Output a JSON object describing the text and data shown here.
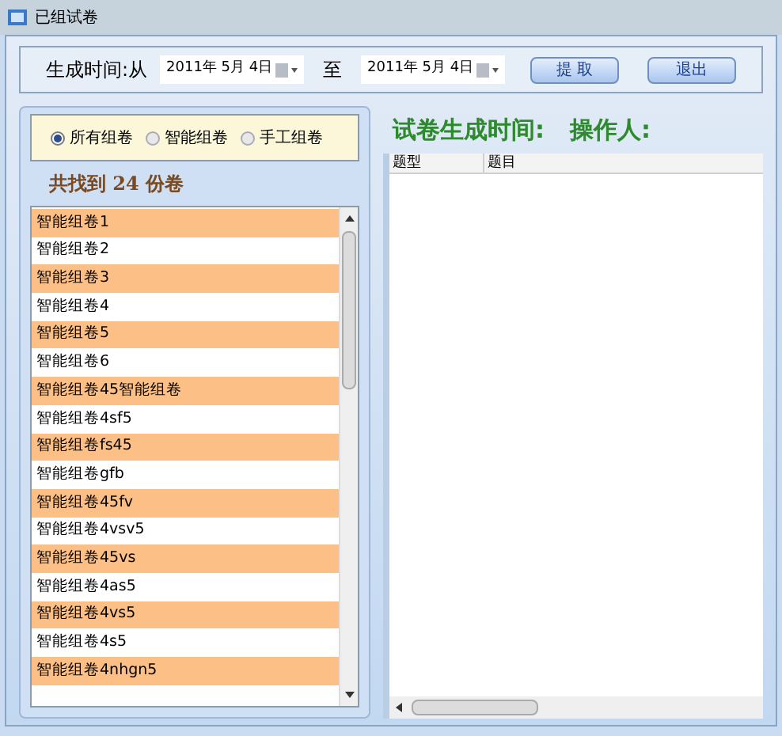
{
  "window": {
    "title": "已组试卷"
  },
  "filter": {
    "from_label": "生成时间:从",
    "from_date": "2011年 5月 4日",
    "to_label": "至",
    "to_date": "2011年 5月 4日",
    "buttons": [
      "提 取",
      "退出"
    ]
  },
  "group_types": [
    {
      "label": "所有组卷",
      "selected": true
    },
    {
      "label": "智能组卷",
      "selected": false
    },
    {
      "label": "手工组卷",
      "selected": false
    }
  ],
  "count_text": "共找到 24 份卷",
  "papers": [
    "智能组卷1",
    "智能组卷2",
    "智能组卷3",
    "智能组卷4",
    "智能组卷5",
    "智能组卷6",
    "智能组卷45智能组卷",
    "智能组卷4sf5",
    "智能组卷fs45",
    "智能组卷gfb",
    "智能组卷45fv",
    "智能组卷4vsv5",
    "智能组卷45vs",
    "智能组卷4as5",
    "智能组卷4vs5",
    "智能组卷4s5",
    "智能组卷4nhgn5"
  ],
  "detail": {
    "time_label": "试卷生成时间:",
    "operator_label": "操作人:",
    "columns": [
      "题型",
      "题目"
    ]
  }
}
